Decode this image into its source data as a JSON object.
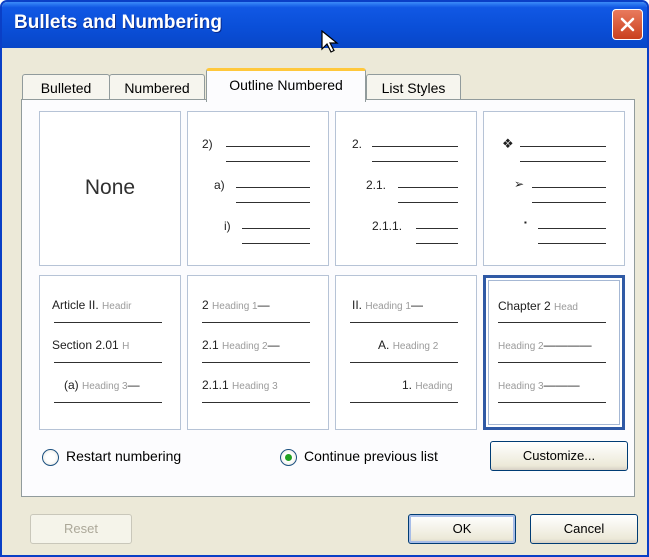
{
  "window": {
    "title": "Bullets and Numbering"
  },
  "tabs": [
    {
      "label": "Bulleted",
      "active": false
    },
    {
      "label": "Numbered",
      "active": false
    },
    {
      "label": "Outline Numbered",
      "active": true
    },
    {
      "label": "List Styles",
      "active": false
    }
  ],
  "gallery": {
    "none_label": "None",
    "cell2": {
      "l1": "2)",
      "l2": "a)",
      "l3": "i)"
    },
    "cell3": {
      "l1": "2.",
      "l2": "2.1.",
      "l3": "2.1.1."
    },
    "cell4": {
      "b1": "❖",
      "b2": "➢",
      "b3": "▪"
    },
    "cell5": {
      "l1_bold": "Article II.",
      "l1_gray": "Headir",
      "l2_bold": "Section 2.01",
      "l2_gray": "H",
      "l3_bold": "(a)",
      "l3_gray": "Heading 3"
    },
    "cell6": {
      "l1_bold": "2",
      "l1_gray": "Heading 1",
      "l2_bold": "2.1",
      "l2_gray": "Heading 2",
      "l3_bold": "2.1.1",
      "l3_gray": "Heading 3"
    },
    "cell7": {
      "l1_bold": "II.",
      "l1_gray": "Heading 1",
      "l2_bold": "A.",
      "l2_gray": "Heading 2",
      "l3_bold": "1.",
      "l3_gray": "Heading"
    },
    "cell8": {
      "l1_bold": "Chapter 2",
      "l1_gray": "Head",
      "l2_gray": "Heading 2",
      "l3_gray": "Heading 3"
    }
  },
  "options": {
    "restart_label": "Restart numbering",
    "continue_label": "Continue previous list",
    "selected": "continue",
    "customize_label": "Customize..."
  },
  "buttons": {
    "reset_label": "Reset",
    "ok_label": "OK",
    "cancel_label": "Cancel"
  }
}
